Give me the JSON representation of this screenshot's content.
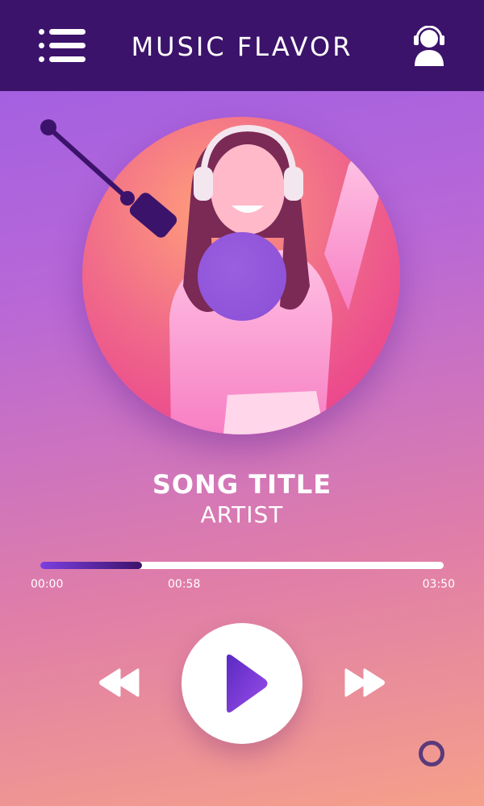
{
  "header": {
    "title": "MUSIC FLAVOR",
    "menu_icon": "menu-list-icon",
    "user_icon": "user-headphones-icon"
  },
  "player": {
    "song_title": "SONG TITLE",
    "artist": "ARTIST",
    "time_start": "00:00",
    "time_current": "00:58",
    "time_total": "03:50",
    "progress_fraction": 0.252
  },
  "controls": {
    "rewind_icon": "rewind-icon",
    "play_icon": "play-icon",
    "forward_icon": "fast-forward-icon"
  },
  "colors": {
    "header_bg": "#3c136b",
    "accent": "#7b3fe0",
    "disc": "#e8338f"
  }
}
